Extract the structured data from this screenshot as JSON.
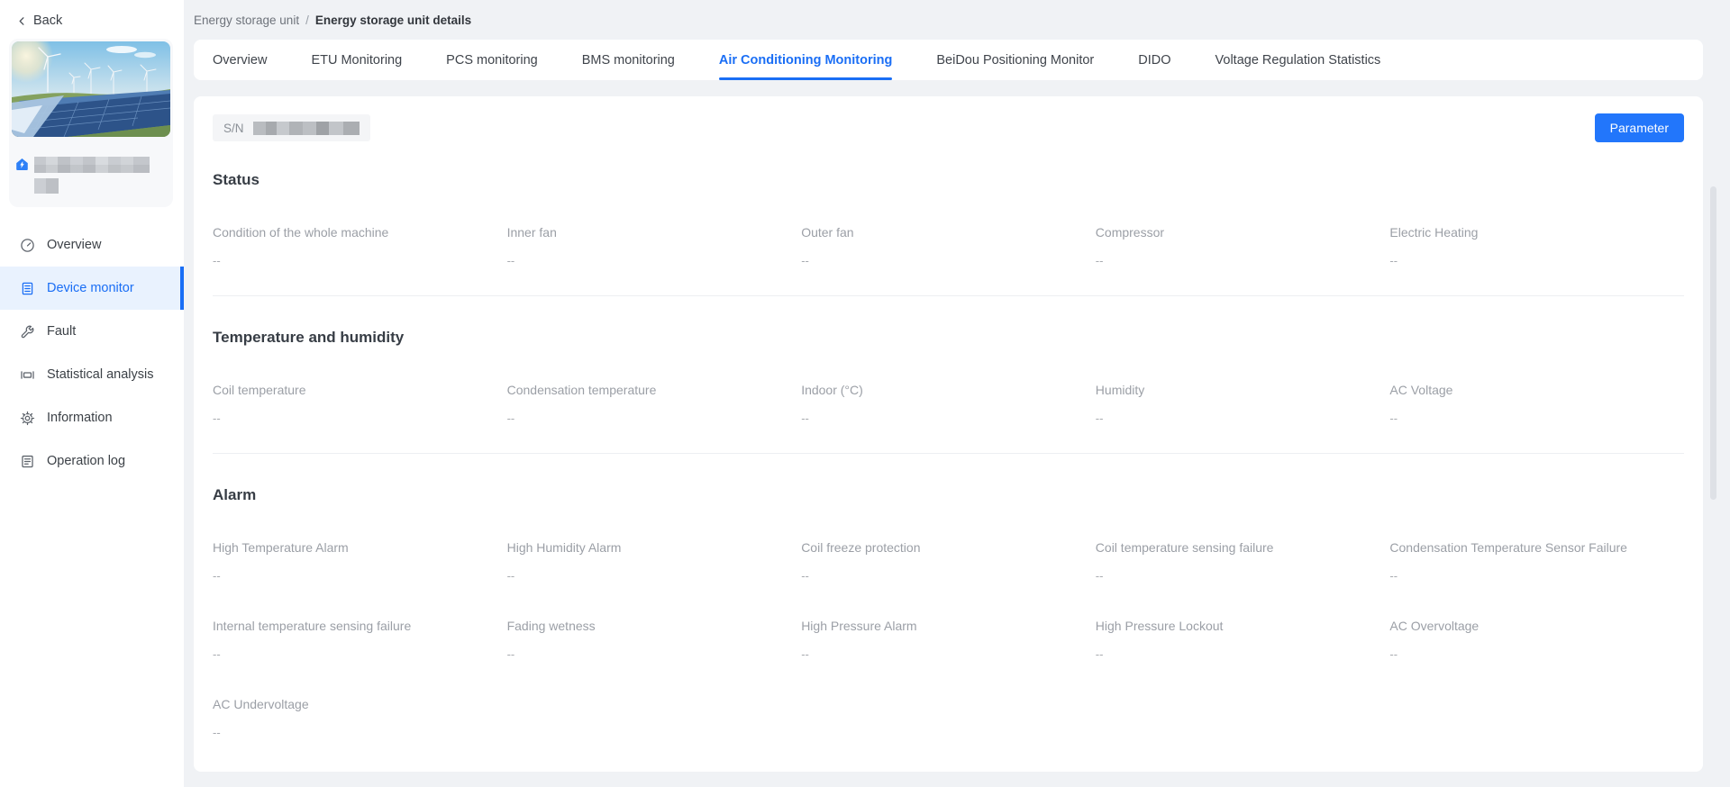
{
  "colors": {
    "accent": "#1a6ef5",
    "button": "#2276fb",
    "active_nav_bg": "#e9f2fe",
    "page_bg": "#f0f2f5"
  },
  "sidebar": {
    "back_label": "Back",
    "site": {
      "name_masked": true,
      "badge_icon": "house-energy-icon"
    },
    "items": [
      {
        "label": "Overview",
        "icon": "gauge-icon",
        "active": false
      },
      {
        "label": "Device monitor",
        "icon": "device-monitor-icon",
        "active": true
      },
      {
        "label": "Fault",
        "icon": "wrench-icon",
        "active": false
      },
      {
        "label": "Statistical analysis",
        "icon": "stats-icon",
        "active": false
      },
      {
        "label": "Information",
        "icon": "gear-icon",
        "active": false
      },
      {
        "label": "Operation log",
        "icon": "log-icon",
        "active": false
      }
    ]
  },
  "breadcrumb": {
    "parent": "Energy storage unit",
    "separator": "/",
    "current": "Energy storage unit details"
  },
  "tabs": [
    {
      "label": "Overview",
      "active": false
    },
    {
      "label": "ETU Monitoring",
      "active": false
    },
    {
      "label": "PCS monitoring",
      "active": false
    },
    {
      "label": "BMS monitoring",
      "active": false
    },
    {
      "label": "Air Conditioning Monitoring",
      "active": true
    },
    {
      "label": "BeiDou Positioning Monitor",
      "active": false
    },
    {
      "label": "DIDO",
      "active": false
    },
    {
      "label": "Voltage Regulation Statistics",
      "active": false
    }
  ],
  "toolbar": {
    "sn_label": "S/N",
    "sn_value_masked": true,
    "parameter_button": "Parameter"
  },
  "sections": [
    {
      "title": "Status",
      "fields": [
        {
          "label": "Condition of the whole machine",
          "value": "--"
        },
        {
          "label": "Inner fan",
          "value": "--"
        },
        {
          "label": "Outer fan",
          "value": "--"
        },
        {
          "label": "Compressor",
          "value": "--"
        },
        {
          "label": "Electric Heating",
          "value": "--"
        }
      ]
    },
    {
      "title": "Temperature and humidity",
      "fields": [
        {
          "label": "Coil temperature",
          "value": "--"
        },
        {
          "label": "Condensation temperature",
          "value": "--"
        },
        {
          "label": "Indoor (°C)",
          "value": "--"
        },
        {
          "label": "Humidity",
          "value": "--"
        },
        {
          "label": "AC Voltage",
          "value": "--"
        }
      ]
    },
    {
      "title": "Alarm",
      "fields": [
        {
          "label": "High Temperature Alarm",
          "value": "--"
        },
        {
          "label": "High Humidity Alarm",
          "value": "--"
        },
        {
          "label": "Coil freeze protection",
          "value": "--"
        },
        {
          "label": "Coil temperature sensing failure",
          "value": "--"
        },
        {
          "label": "Condensation Temperature Sensor Failure",
          "value": "--"
        },
        {
          "label": "Internal temperature sensing failure",
          "value": "--"
        },
        {
          "label": "Fading wetness",
          "value": "--"
        },
        {
          "label": "High Pressure Alarm",
          "value": "--"
        },
        {
          "label": "High Pressure Lockout",
          "value": "--"
        },
        {
          "label": "AC Overvoltage",
          "value": "--"
        },
        {
          "label": "AC Undervoltage",
          "value": "--"
        }
      ]
    }
  ]
}
